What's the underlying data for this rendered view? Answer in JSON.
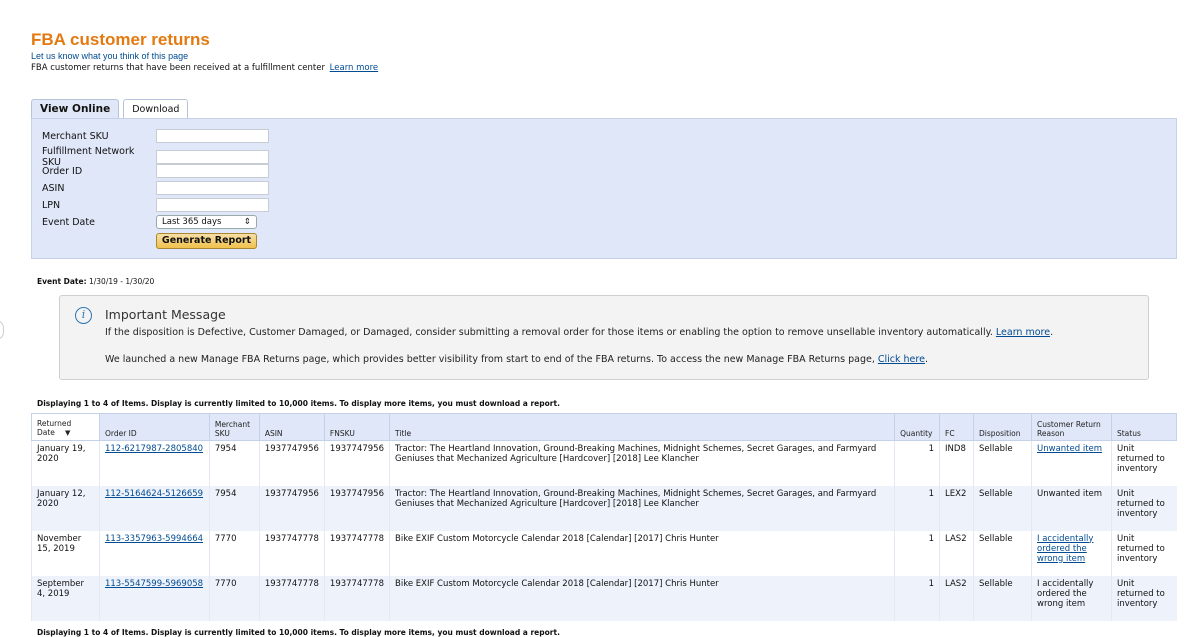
{
  "header": {
    "title": "FBA customer returns",
    "feedback_link": "Let us know what you think of this page",
    "description": "FBA customer returns that have been received at a fulfillment center",
    "learn_more": "Learn more"
  },
  "tabs": [
    {
      "label": "View Online",
      "active": true
    },
    {
      "label": "Download",
      "active": false
    }
  ],
  "form": {
    "fields": [
      {
        "label": "Merchant SKU",
        "value": ""
      },
      {
        "label": "Fulfillment Network SKU",
        "value": ""
      },
      {
        "label": "Order ID",
        "value": ""
      },
      {
        "label": "ASIN",
        "value": ""
      },
      {
        "label": "LPN",
        "value": ""
      }
    ],
    "event_date_label": "Event Date",
    "event_date_selected": "Last 365 days",
    "generate_button": "Generate Report"
  },
  "event_date_line": {
    "label": "Event Date:",
    "value": "1/30/19 - 1/30/20"
  },
  "message": {
    "title": "Important Message",
    "line1": "If the disposition is Defective, Customer Damaged, or Damaged, consider submitting a removal order for those items or enabling the option to remove unsellable inventory automatically.",
    "line1_link": "Learn more",
    "line2": "We launched a new Manage FBA Returns page, which provides better visibility from start to end of the FBA returns. To access the new Manage FBA Returns page,",
    "line2_link": "Click here"
  },
  "display_note": "Displaying 1 to 4 of Items. Display is currently limited to 10,000 items. To display more items, you must download a report.",
  "table": {
    "columns": {
      "returned_date": "Returned Date",
      "order_id": "Order ID",
      "merchant_sku": "Merchant SKU",
      "asin": "ASIN",
      "fnsku": "FNSKU",
      "title": "Title",
      "quantity": "Quantity",
      "fc": "FC",
      "disposition": "Disposition",
      "reason": "Customer Return Reason",
      "status": "Status"
    },
    "rows": [
      {
        "date": "January 19, 2020",
        "order_id": "112-6217987-2805840",
        "sku": "7954",
        "asin": "1937747956",
        "fnsku": "1937747956",
        "title": "Tractor: The Heartland Innovation, Ground-Breaking Machines, Midnight Schemes, Secret Garages, and Farmyard Geniuses that Mechanized Agriculture [Hardcover] [2018] Lee Klancher",
        "quantity": "1",
        "fc": "IND8",
        "disposition": "Sellable",
        "reason": "Unwanted item",
        "reason_is_link": true,
        "status": "Unit returned to inventory"
      },
      {
        "date": "January 12, 2020",
        "order_id": "112-5164624-5126659",
        "sku": "7954",
        "asin": "1937747956",
        "fnsku": "1937747956",
        "title": "Tractor: The Heartland Innovation, Ground-Breaking Machines, Midnight Schemes, Secret Garages, and Farmyard Geniuses that Mechanized Agriculture [Hardcover] [2018] Lee Klancher",
        "quantity": "1",
        "fc": "LEX2",
        "disposition": "Sellable",
        "reason": "Unwanted item",
        "reason_is_link": false,
        "status": "Unit returned to inventory"
      },
      {
        "date": "November 15, 2019",
        "order_id": "113-3357963-5994664",
        "sku": "7770",
        "asin": "1937747778",
        "fnsku": "1937747778",
        "title": "Bike EXIF Custom Motorcycle Calendar 2018 [Calendar] [2017] Chris Hunter",
        "quantity": "1",
        "fc": "LAS2",
        "disposition": "Sellable",
        "reason": "I accidentally ordered the wrong item",
        "reason_is_link": true,
        "status": "Unit returned to inventory"
      },
      {
        "date": "September 4, 2019",
        "order_id": "113-5547599-5969058",
        "sku": "7770",
        "asin": "1937747778",
        "fnsku": "1937747778",
        "title": "Bike EXIF Custom Motorcycle Calendar 2018 [Calendar] [2017] Chris Hunter",
        "quantity": "1",
        "fc": "LAS2",
        "disposition": "Sellable",
        "reason": "I accidentally ordered the wrong item",
        "reason_is_link": false,
        "status": "Unit returned to inventory"
      }
    ]
  },
  "colors": {
    "title_orange": "#e47911",
    "link_blue": "#004b91",
    "panel_blue": "#dfe7f8",
    "button_gold": "#f0c14b"
  }
}
